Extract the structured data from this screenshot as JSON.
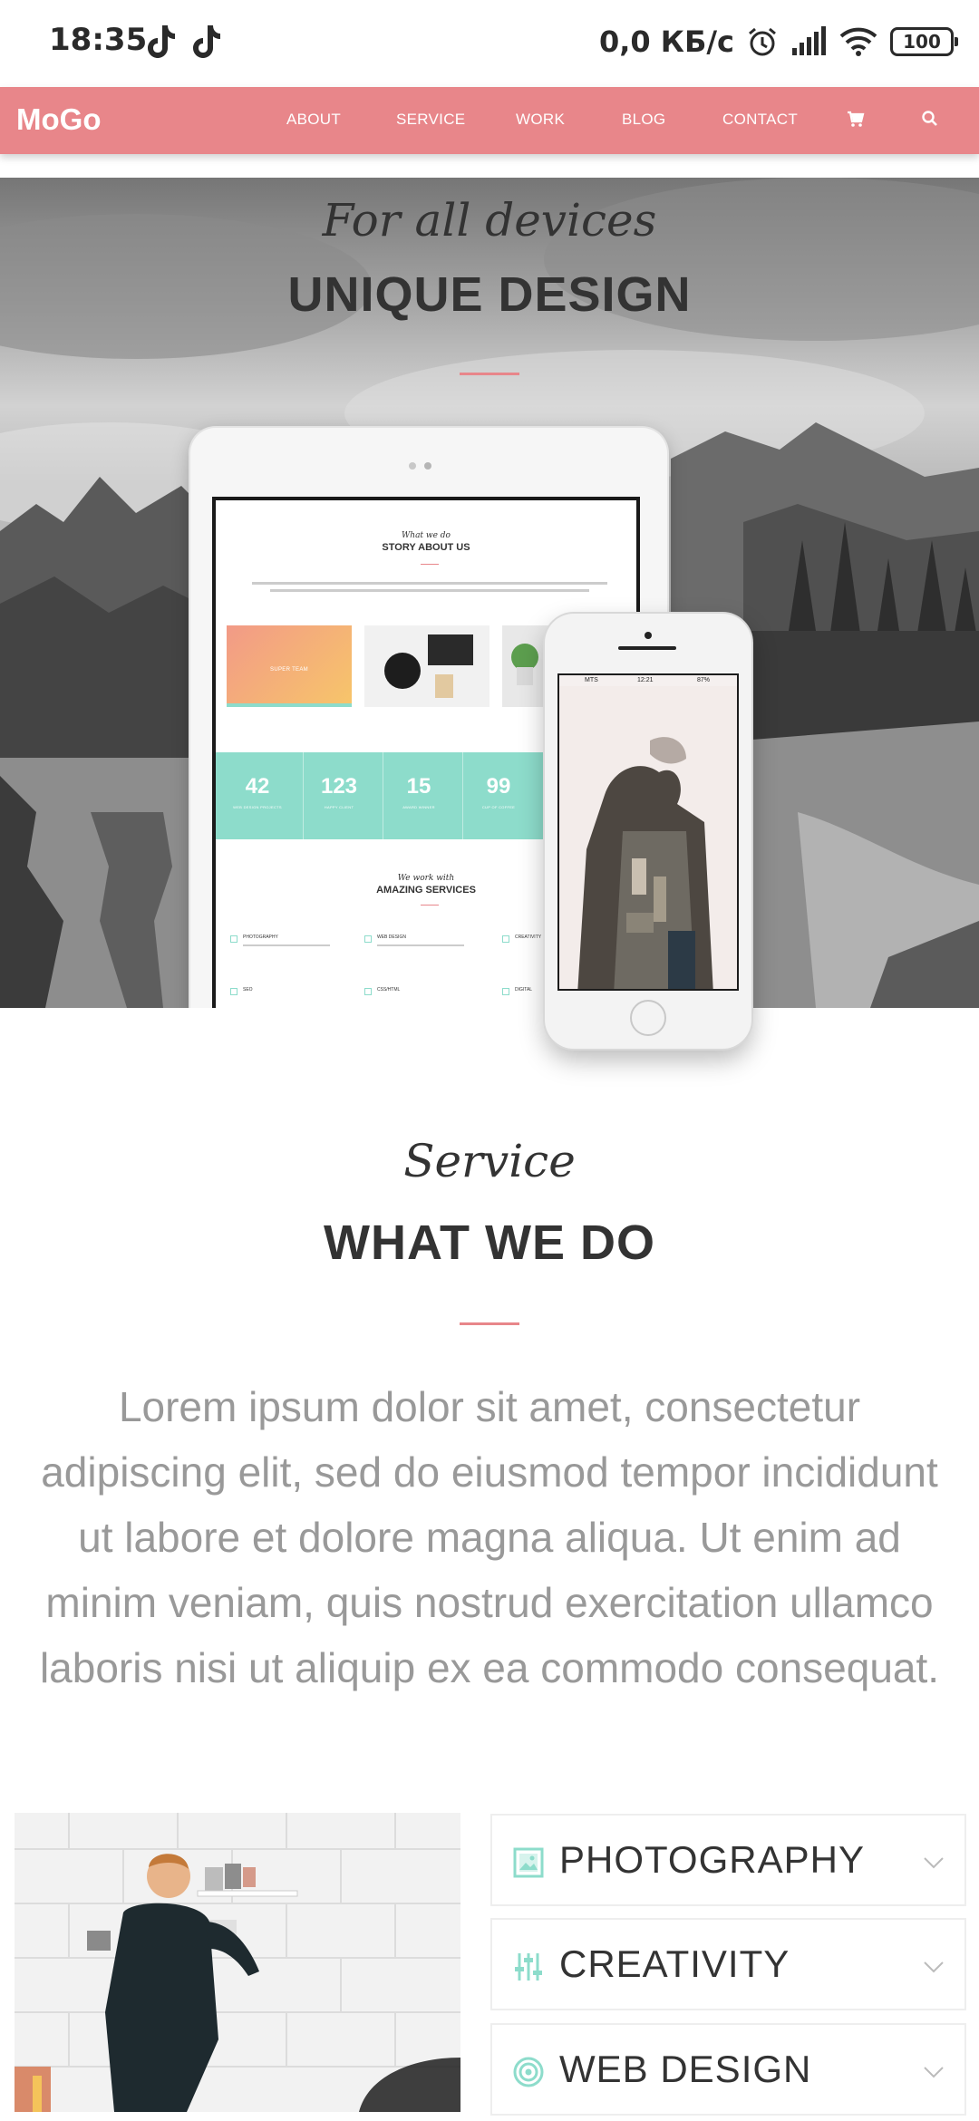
{
  "status_bar": {
    "time": "18:35",
    "network_speed": "0,0 КБ/с",
    "battery": "100",
    "icons": [
      "tiktok-icon",
      "tiktok-icon",
      "alarm-icon",
      "signal-icon",
      "wifi-icon",
      "battery-icon"
    ]
  },
  "nav": {
    "brand": "MoGo",
    "links": [
      "ABOUT",
      "SERVICE",
      "WORK",
      "BLOG",
      "CONTACT"
    ],
    "icons": [
      "cart-icon",
      "search-icon"
    ],
    "background": "#e8868a"
  },
  "hero": {
    "subtitle": "For all devices",
    "title": "UNIQUE DESIGN",
    "tablet": {
      "script": "What we do",
      "heading": "STORY ABOUT US",
      "card_label": "SUPER TEAM",
      "stats": [
        {
          "value": "42",
          "label": "WEB DESIGN PROJECTS"
        },
        {
          "value": "123",
          "label": "HAPPY CLIENT"
        },
        {
          "value": "15",
          "label": "AWARD WINNER"
        },
        {
          "value": "99",
          "label": "CUP OF COFFEE"
        }
      ],
      "services_script": "We work with",
      "services_heading": "AMAZING SERVICES",
      "services": [
        "PHOTOGRAPHY",
        "WEB DESIGN",
        "CREATIVITY",
        "SEO",
        "CSS/HTML",
        "DIGITAL"
      ]
    },
    "phone": {
      "carrier": "MTS",
      "time": "12:21",
      "battery": "87%"
    }
  },
  "service": {
    "script": "Service",
    "title": "WHAT WE DO",
    "text": "Lorem ipsum dolor sit amet, consectetur adipiscing elit, sed do eiusmod tempor incididunt ut labore et dolore magna aliqua. Ut enim ad minim veniam, quis nostrud exercitation ullamco laboris nisi ut aliquip ex ea commodo consequat.",
    "accordion": [
      {
        "label": "PHOTOGRAPHY",
        "icon": "image-icon"
      },
      {
        "label": "CREATIVITY",
        "icon": "equalizer-icon"
      },
      {
        "label": "WEB DESIGN",
        "icon": "target-icon"
      }
    ],
    "accent_color": "#8ddccb"
  }
}
